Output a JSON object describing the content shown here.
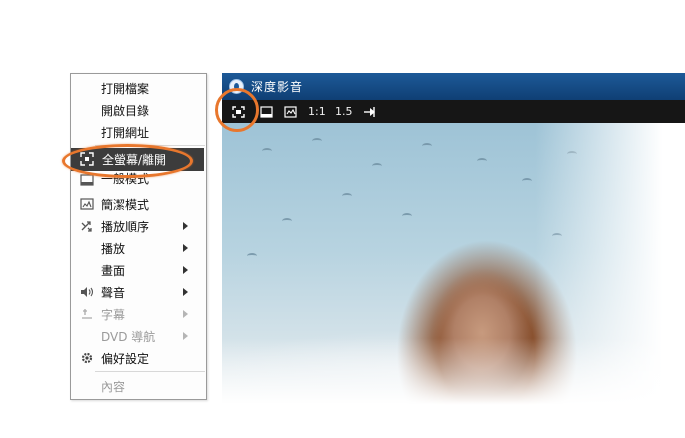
{
  "player": {
    "title": "深度影音",
    "toolbar": {
      "fullscreen_icon": "fullscreen-icon",
      "compact_icon": "compact-mode-icon",
      "simple_icon": "simple-mode-icon",
      "scale_1": "1:1",
      "scale_15": "1.5",
      "pin_icon": "pin-icon"
    }
  },
  "menu": {
    "items": [
      {
        "label": "打開檔案",
        "icon": "",
        "submenu": false,
        "disabled": false
      },
      {
        "label": "開啟目錄",
        "icon": "",
        "submenu": false,
        "disabled": false
      },
      {
        "label": "打開網址",
        "icon": "",
        "submenu": false,
        "disabled": false
      },
      {
        "label": "全螢幕/離開",
        "icon": "fullscreen-icon",
        "submenu": false,
        "disabled": false,
        "highlighted": true
      },
      {
        "label": "一般模式",
        "icon": "normal-mode-icon",
        "submenu": false,
        "disabled": false
      },
      {
        "label": "簡潔模式",
        "icon": "simple-mode-icon",
        "submenu": false,
        "disabled": false
      },
      {
        "label": "播放順序",
        "icon": "shuffle-icon",
        "submenu": true,
        "disabled": false
      },
      {
        "label": "播放",
        "icon": "",
        "submenu": true,
        "disabled": false
      },
      {
        "label": "畫面",
        "icon": "",
        "submenu": true,
        "disabled": false
      },
      {
        "label": "聲音",
        "icon": "volume-icon",
        "submenu": true,
        "disabled": false
      },
      {
        "label": "字幕",
        "icon": "subtitle-icon",
        "submenu": true,
        "disabled": true
      },
      {
        "label": "DVD 導航",
        "icon": "",
        "submenu": true,
        "disabled": true
      },
      {
        "label": "偏好設定",
        "icon": "gear-icon",
        "submenu": false,
        "disabled": false
      },
      {
        "label": "內容",
        "icon": "",
        "submenu": false,
        "disabled": true
      }
    ]
  },
  "colors": {
    "callout": "#e8772d",
    "titlebar": "#1d5a98",
    "toolbar": "#161616",
    "menu_highlight": "#3c3c3c"
  }
}
